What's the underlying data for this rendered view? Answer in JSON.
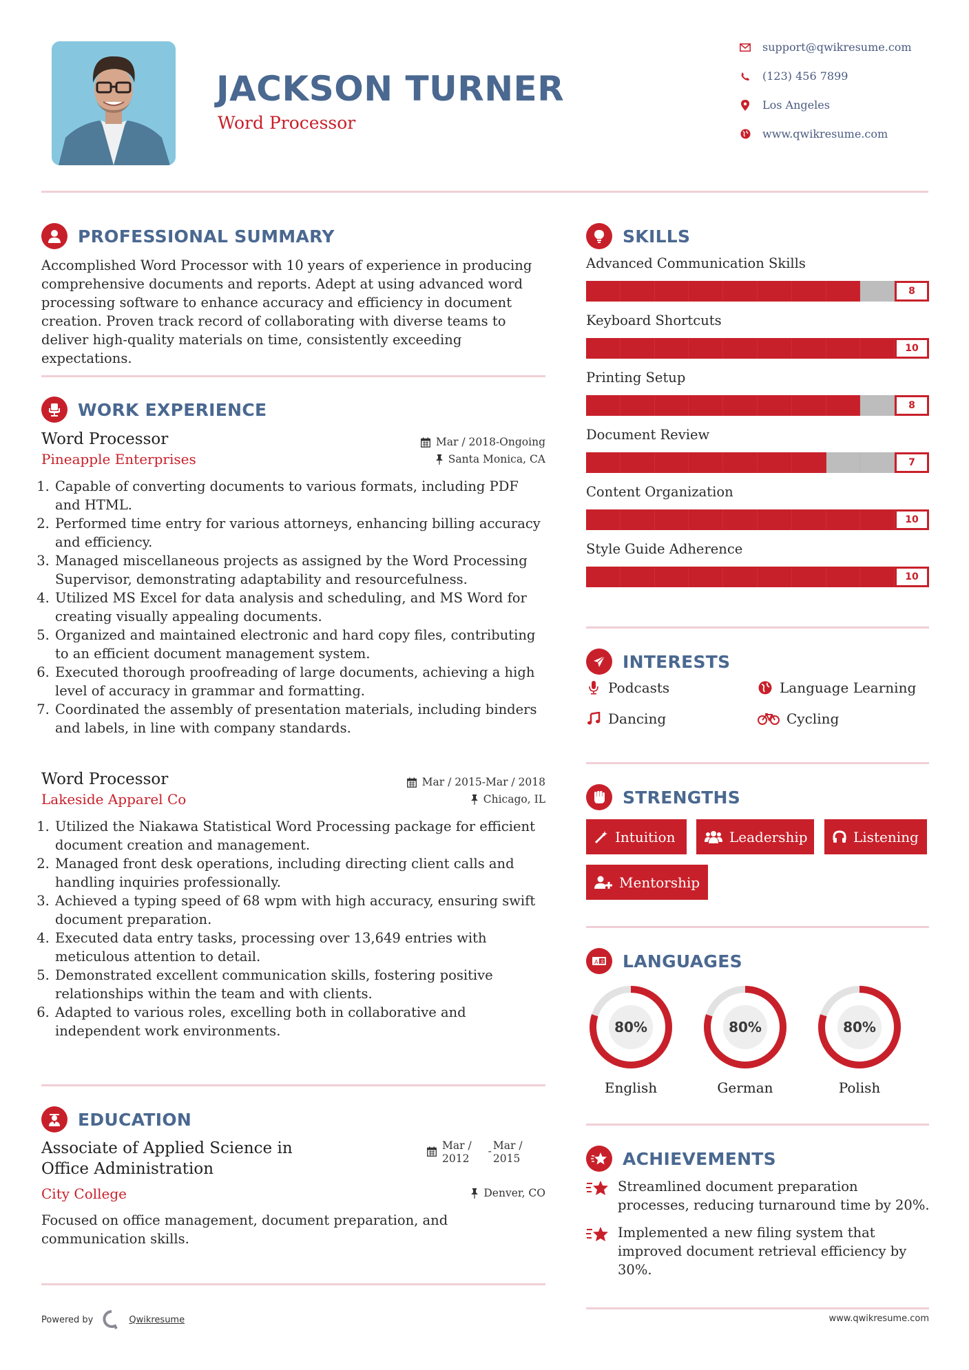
{
  "header": {
    "name": "JACKSON TURNER",
    "title": "Word Processor",
    "photo_alt": "profile-photo"
  },
  "contact": [
    {
      "icon": "envelope-icon",
      "text": "support@qwikresume.com"
    },
    {
      "icon": "phone-icon",
      "text": "(123) 456 7899"
    },
    {
      "icon": "map-marker-icon",
      "text": "Los Angeles"
    },
    {
      "icon": "globe-icon",
      "text": "www.qwikresume.com"
    }
  ],
  "summary": {
    "heading": "PROFESSIONAL SUMMARY",
    "icon": "user-icon",
    "text": "Accomplished Word Processor with 10 years of experience in producing comprehensive documents and reports. Adept at using advanced word processing software to enhance accuracy and efficiency in document creation. Proven track record of collaborating with diverse teams to deliver high-quality materials on time, consistently exceeding expectations."
  },
  "experience": {
    "heading": "WORK EXPERIENCE",
    "icon": "office-chair-icon",
    "jobs": [
      {
        "title": "Word Processor",
        "company": "Pineapple Enterprises",
        "dates": "Mar / 2018-Ongoing",
        "location": "Santa Monica, CA",
        "bullets": [
          "Capable of converting documents to various formats, including PDF and HTML.",
          "Performed time entry for various attorneys, enhancing billing accuracy and efficiency.",
          "Managed miscellaneous projects as assigned by the Word Processing Supervisor, demonstrating adaptability and resourcefulness.",
          "Utilized MS Excel for data analysis and scheduling, and MS Word for creating visually appealing documents.",
          "Organized and maintained electronic and hard copy files, contributing to an efficient document management system.",
          "Executed thorough proofreading of large documents, achieving a high level of accuracy in grammar and formatting.",
          "Coordinated the assembly of presentation materials, including binders and labels, in line with company standards."
        ]
      },
      {
        "title": "Word Processor",
        "company": "Lakeside Apparel Co",
        "dates": "Mar / 2015-Mar / 2018",
        "location": "Chicago, IL",
        "bullets": [
          "Utilized the Niakawa Statistical Word Processing package for efficient document creation and management.",
          "Managed front desk operations, including directing client calls and handling inquiries professionally.",
          "Achieved a typing speed of 68 wpm with high accuracy, ensuring swift document preparation.",
          "Executed data entry tasks, processing over 13,649 entries with meticulous attention to detail.",
          "Demonstrated excellent communication skills, fostering positive relationships within the team and with clients.",
          "Adapted to various roles, excelling both in collaborative and independent work environments."
        ]
      }
    ]
  },
  "education": {
    "heading": "EDUCATION",
    "icon": "graduate-icon",
    "degree": "Associate of Applied Science in Office Administration",
    "school": "City College",
    "start_month": "Mar /",
    "start_year": "2012",
    "sep": "-",
    "end_month": "Mar /",
    "end_year": "2015",
    "location": "Denver, CO",
    "description": "Focused on office management, document preparation, and communication skills."
  },
  "skills": {
    "heading": "SKILLS",
    "icon": "lightbulb-icon",
    "max": 10,
    "items": [
      {
        "label": "Advanced Communication Skills",
        "level": 8
      },
      {
        "label": "Keyboard Shortcuts",
        "level": 10
      },
      {
        "label": "Printing Setup",
        "level": 8
      },
      {
        "label": "Document Review",
        "level": 7
      },
      {
        "label": "Content Organization",
        "level": 10
      },
      {
        "label": "Style Guide Adherence",
        "level": 10
      }
    ]
  },
  "interests": {
    "heading": "INTERESTS",
    "icon": "paper-plane-icon",
    "items": [
      {
        "label": "Podcasts",
        "icon": "microphone-icon"
      },
      {
        "label": "Language Learning",
        "icon": "globe-icon"
      },
      {
        "label": "Dancing",
        "icon": "music-note-icon"
      },
      {
        "label": "Cycling",
        "icon": "bicycle-icon"
      }
    ]
  },
  "strengths": {
    "heading": "STRENGTHS",
    "icon": "fist-icon",
    "items": [
      {
        "label": "Intuition",
        "icon": "magic-wand-icon"
      },
      {
        "label": "Leadership",
        "icon": "users-icon"
      },
      {
        "label": "Listening",
        "icon": "headphones-icon"
      },
      {
        "label": "Mentorship",
        "icon": "user-plus-icon"
      }
    ]
  },
  "languages": {
    "heading": "LANGUAGES",
    "icon": "language-icon",
    "items": [
      {
        "label": "English",
        "percent": 80,
        "display": "80%"
      },
      {
        "label": "German",
        "percent": 80,
        "display": "80%"
      },
      {
        "label": "Polish",
        "percent": 80,
        "display": "80%"
      }
    ]
  },
  "achievements": {
    "heading": "ACHIEVEMENTS",
    "icon": "star-badge-icon",
    "items": [
      "Streamlined document preparation processes, reducing turnaround time by 20%.",
      "Implemented a new filing system that improved document retrieval efficiency by 30%."
    ]
  },
  "footer": {
    "powered_by": "Powered by",
    "brand": "Qwikresume",
    "site": "www.qwikresume.com"
  },
  "colors": {
    "accent": "#c8202a",
    "heading": "#4a6890",
    "divider": "#f0cfd5",
    "bar_empty": "#bdbdbd"
  }
}
